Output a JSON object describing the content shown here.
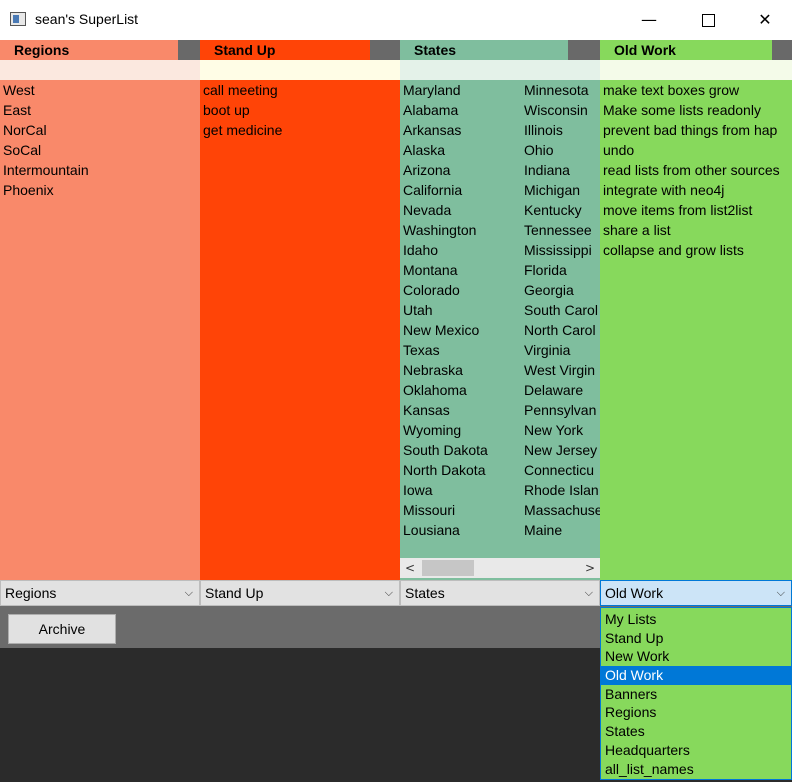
{
  "window": {
    "title": "sean's SuperList",
    "minimize": "—",
    "close": "✕"
  },
  "columns": [
    {
      "header": "Regions",
      "items": [
        "West",
        "East",
        "NorCal",
        "SoCal",
        "Intermountain",
        "Phoenix"
      ],
      "combo": "Regions",
      "color": "#f9896a"
    },
    {
      "header": "Stand Up",
      "items": [
        "call meeting",
        "boot up",
        "get medicine"
      ],
      "combo": "Stand Up",
      "color": "#ff4407"
    },
    {
      "header": "States",
      "items_left": [
        "Maryland",
        "Alabama",
        "Arkansas",
        "Alaska",
        "Arizona",
        "California",
        "Nevada",
        "Washington",
        "Idaho",
        "Montana",
        "Colorado",
        "Utah",
        "New Mexico",
        "Texas",
        "Nebraska",
        "Oklahoma",
        "Kansas",
        "Wyoming",
        "South Dakota",
        "North Dakota",
        "Iowa",
        "Missouri",
        "Lousiana"
      ],
      "items_right": [
        "Minnesota",
        "Wisconsin",
        "Illinois",
        "Ohio",
        "Indiana",
        "Michigan",
        "Kentucky",
        "Tennessee",
        "Mississippi",
        "Florida",
        "Georgia",
        "South Carol",
        "North Carol",
        "Virginia",
        "West Virgin",
        "Delaware",
        "Pennsylvan",
        "New York",
        "New Jersey",
        "Connecticu",
        "Rhode Islan",
        "Massachuse",
        "Maine"
      ],
      "combo": "States",
      "color": "#7fbe9e"
    },
    {
      "header": "Old Work",
      "items": [
        "make text boxes grow",
        "Make some lists readonly",
        "prevent bad things from hap",
        "undo",
        "read lists from other sources",
        "integrate with neo4j",
        "move items from list2list",
        "share a list",
        "collapse and grow lists"
      ],
      "combo": "Old Work",
      "color": "#87d95c"
    }
  ],
  "scrollbar": {
    "left": "<",
    "right": ">"
  },
  "archive_label": "Archive",
  "dropdown": {
    "options": [
      "My Lists",
      "Stand Up",
      "New Work",
      "Old Work",
      "Banners",
      "Regions",
      "States",
      "Headquarters",
      "all_list_names"
    ],
    "selected": "Old Work"
  }
}
